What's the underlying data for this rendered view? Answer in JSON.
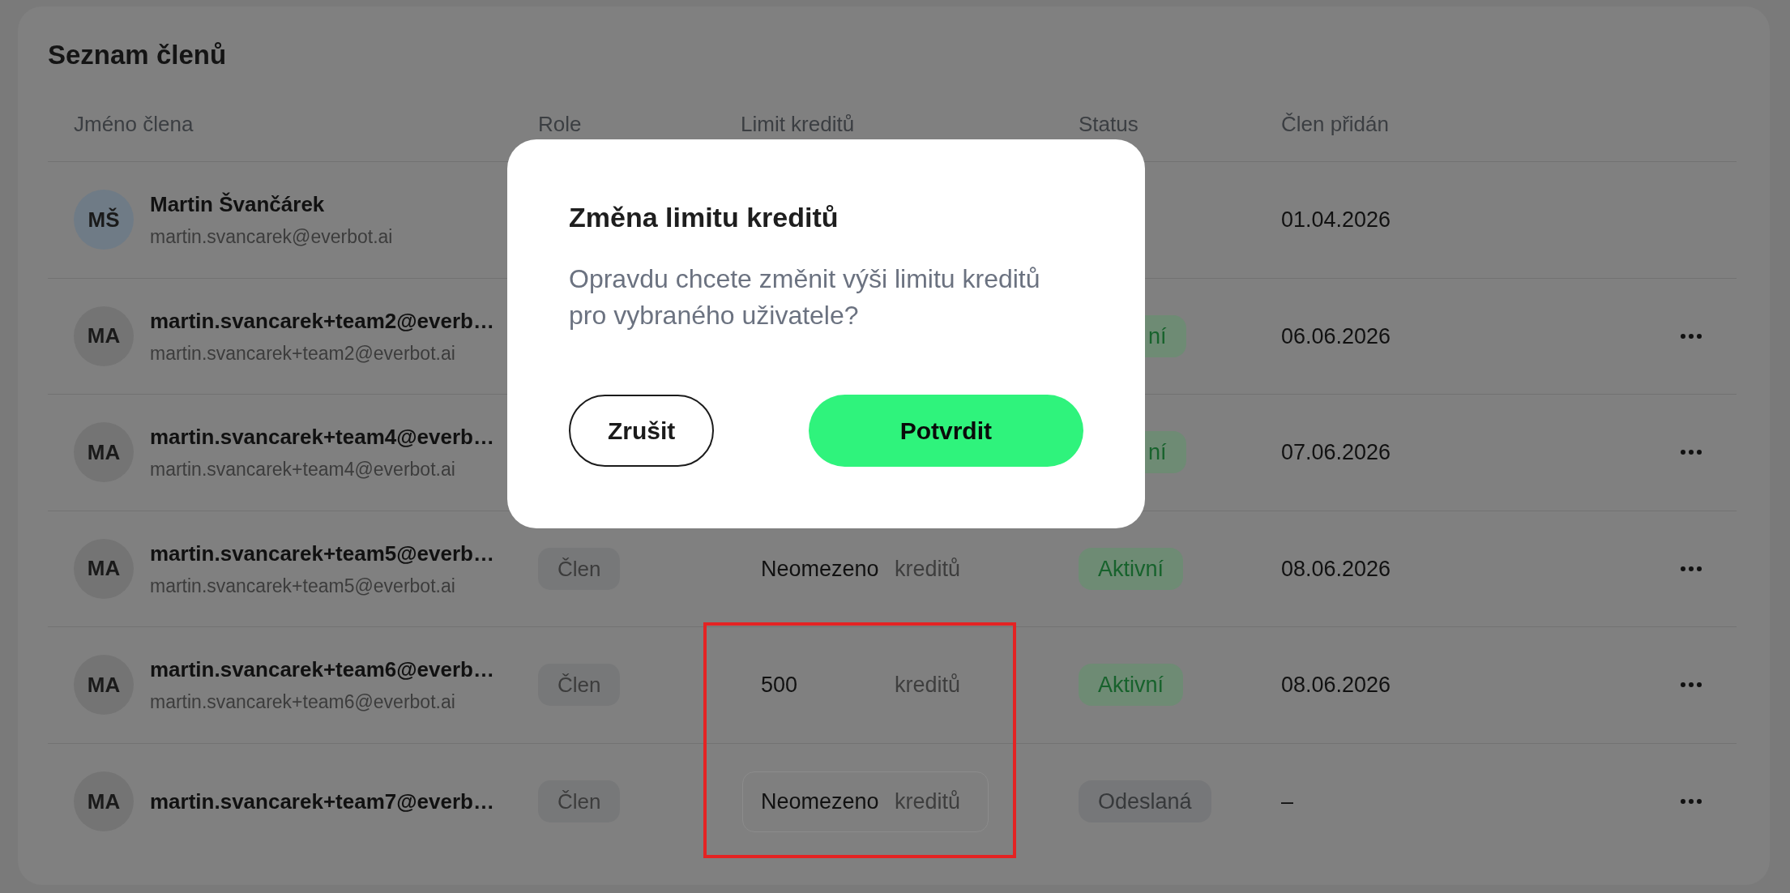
{
  "panel": {
    "title": "Seznam členů"
  },
  "table": {
    "columns": [
      "Jméno člena",
      "Role",
      "Limit kreditů",
      "Status",
      "Člen přidán"
    ],
    "rows": [
      {
        "avatar": {
          "initials": "MŠ",
          "color": "#6f7b86"
        },
        "name": "Martin Švančárek",
        "email": "martin.svancarek@everbot.ai",
        "date": "01.04.2026",
        "menu": false
      },
      {
        "avatar": {
          "initials": "MA",
          "color": "#747474"
        },
        "name": "martin.svancarek+team2@everb…",
        "email": "martin.svancarek+team2@everbot.ai",
        "status": {
          "label": "ní",
          "kind": "active",
          "partly_hidden": true
        },
        "date": "06.06.2026",
        "menu": true
      },
      {
        "avatar": {
          "initials": "MA",
          "color": "#747474"
        },
        "name": "martin.svancarek+team4@everb…",
        "email": "martin.svancarek+team4@everbot.ai",
        "status": {
          "label": "ní",
          "kind": "active",
          "partly_hidden": true
        },
        "date": "07.06.2026",
        "menu": true
      },
      {
        "avatar": {
          "initials": "MA",
          "color": "#747474"
        },
        "name": "martin.svancarek+team5@everb…",
        "email": "martin.svancarek+team5@everbot.ai",
        "role": "Člen",
        "limit": {
          "value": "Neomezeno",
          "unit": "kreditů",
          "kind": "text",
          "highlighted": false
        },
        "status": {
          "label": "Aktivní",
          "kind": "active",
          "partly_hidden": false
        },
        "date": "08.06.2026",
        "menu": true
      },
      {
        "avatar": {
          "initials": "MA",
          "color": "#747474"
        },
        "name": "martin.svancarek+team6@everb…",
        "email": "martin.svancarek+team6@everbot.ai",
        "role": "Člen",
        "limit": {
          "value": "500",
          "unit": "kreditů",
          "kind": "text",
          "highlighted": true
        },
        "status": {
          "label": "Aktivní",
          "kind": "active",
          "partly_hidden": false
        },
        "date": "08.06.2026",
        "menu": true
      },
      {
        "avatar": {
          "initials": "MA",
          "color": "#747474"
        },
        "name": "martin.svancarek+team7@everb…",
        "role": "Člen",
        "limit": {
          "value": "Neomezeno",
          "unit": "kreditů",
          "kind": "input",
          "highlighted": true
        },
        "status": {
          "label": "Odeslaná",
          "kind": "sent",
          "partly_hidden": false
        },
        "date": "–",
        "menu": true
      }
    ]
  },
  "dialog": {
    "title": "Změna limitu kreditů",
    "text": "Opravdu chcete změnit výši limitu kreditů pro vybraného uživatele?",
    "buttons": [
      {
        "label": "Zrušit",
        "kind": "secondary"
      },
      {
        "label": "Potvrdit",
        "kind": "primary"
      }
    ]
  }
}
